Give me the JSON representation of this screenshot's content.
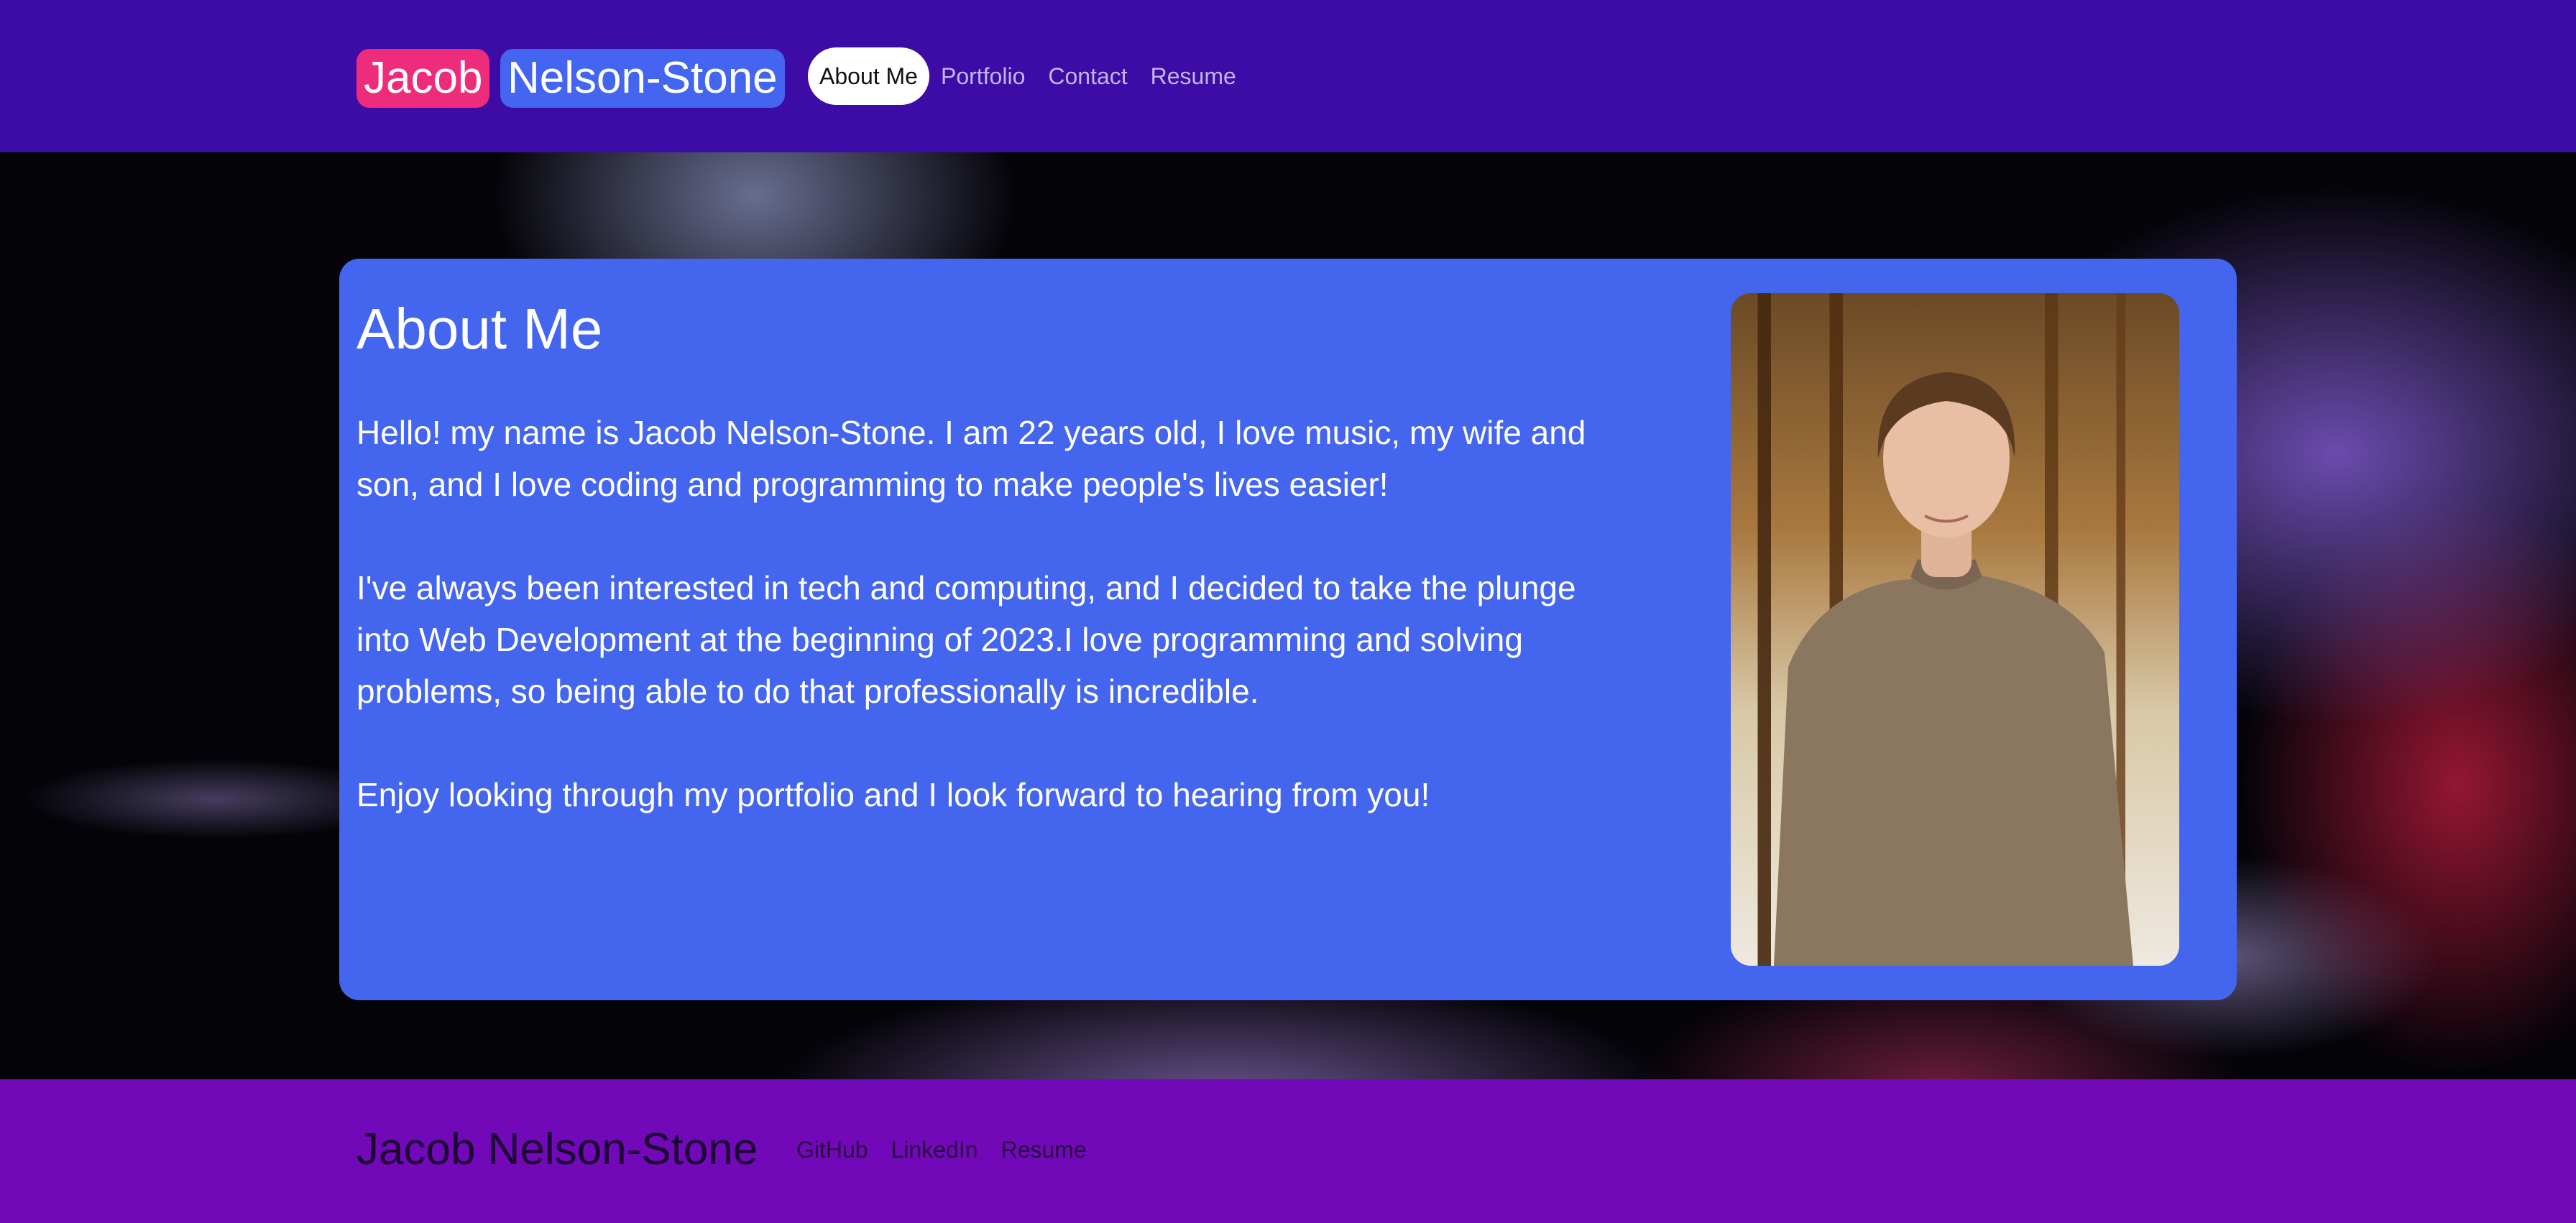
{
  "header": {
    "brand_first": "Jacob",
    "brand_last": "Nelson-Stone",
    "nav": [
      "About Me",
      "Portfolio",
      "Contact",
      "Resume"
    ]
  },
  "about": {
    "title": "About Me",
    "paragraphs": [
      "Hello! my name is Jacob Nelson-Stone. I am 22 years old, I love music, my wife and son, and I love coding and programming to make people's lives easier!",
      "I've always been interested in tech and computing, and I decided to take the plunge into Web Development at the beginning of 2023.I love programming and solving problems, so being able to do that professionally is incredible.",
      "Enjoy looking through my portfolio and I look forward to hearing from you!"
    ]
  },
  "footer": {
    "name": "Jacob Nelson-Stone",
    "links": [
      "GitHub",
      "LinkedIn",
      "Resume"
    ]
  },
  "colors": {
    "header_bg": "#3d0ba6",
    "brand_first_bg": "#ee2c7c",
    "brand_last_bg": "#4365f0",
    "card_bg": "#4465ee",
    "footer_bg": "#7209b8"
  }
}
